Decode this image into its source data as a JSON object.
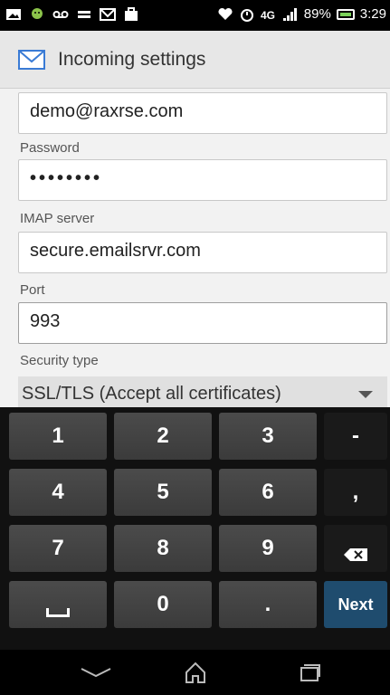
{
  "status_bar": {
    "signal_percent": "89%",
    "time": "3:29"
  },
  "action_bar": {
    "title": "Incoming settings",
    "icon": "mail-icon"
  },
  "form": {
    "username_value": "demo@raxrse.com",
    "password_label": "Password",
    "password_value": "••••••••",
    "imap_label": "IMAP server",
    "imap_value": "secure.emailsrvr.com",
    "port_label": "Port",
    "port_value": "993",
    "security_label": "Security type",
    "security_value": "SSL/TLS (Accept all certificates)"
  },
  "keyboard": {
    "keys": [
      "1",
      "2",
      "3",
      "-",
      "4",
      "5",
      "6",
      ",",
      "7",
      "8",
      "9",
      "0",
      "."
    ],
    "next_label": "Next"
  },
  "colors": {
    "next_key": "#1f4c6e",
    "battery": "#7bd35a"
  }
}
